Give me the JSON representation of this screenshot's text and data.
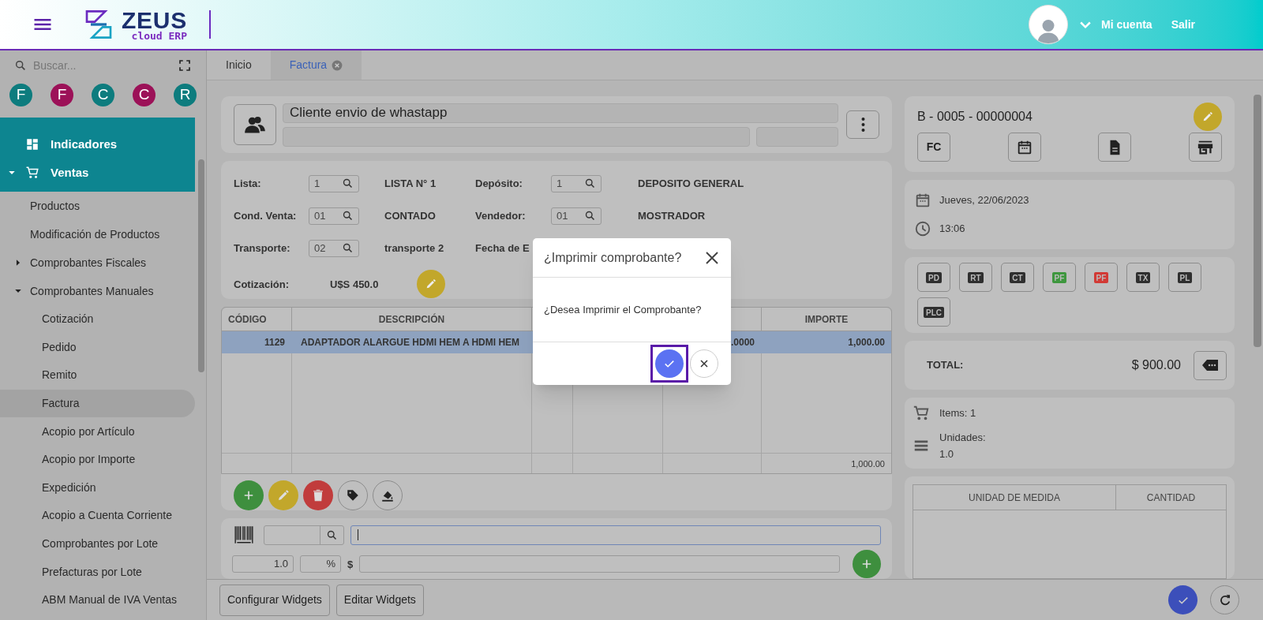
{
  "header": {
    "brand": "ZEUS",
    "brand_sub": "cloud ERP",
    "account": "Mi cuenta",
    "logout": "Salir"
  },
  "sidebar": {
    "search_placeholder": "Buscar...",
    "shortcuts": [
      {
        "letter": "F",
        "color": "#0d7c7e"
      },
      {
        "letter": "F",
        "color": "#9c1158"
      },
      {
        "letter": "C",
        "color": "#0d7c7e"
      },
      {
        "letter": "C",
        "color": "#9c1158"
      },
      {
        "letter": "R",
        "color": "#0d7c7e"
      }
    ],
    "items": [
      {
        "label": "Indicadores",
        "selected": false
      },
      {
        "label": "Ventas",
        "selected": false,
        "expanded": true,
        "children": [
          {
            "label": "Productos",
            "selected": false
          },
          {
            "label": "Modificación de Productos",
            "selected": false
          },
          {
            "label": "Comprobantes Fiscales",
            "selected": false,
            "expanded": false
          },
          {
            "label": "Comprobantes Manuales",
            "selected": false,
            "expanded": true,
            "children": [
              {
                "label": "Cotización",
                "selected": false
              },
              {
                "label": "Pedido",
                "selected": false
              },
              {
                "label": "Remito",
                "selected": false
              },
              {
                "label": "Factura",
                "selected": true
              },
              {
                "label": "Acopio por Artículo",
                "selected": false
              },
              {
                "label": "Acopio por Importe",
                "selected": false
              },
              {
                "label": "Expedición",
                "selected": false
              },
              {
                "label": "Acopio a Cuenta Corriente",
                "selected": false
              },
              {
                "label": "Comprobantes por Lote",
                "selected": false
              },
              {
                "label": "Prefacturas por Lote",
                "selected": false
              },
              {
                "label": "ABM Manual de IVA Ventas",
                "selected": false
              }
            ]
          }
        ]
      }
    ]
  },
  "tabs": [
    {
      "label": "Inicio",
      "selected": false,
      "closable": false
    },
    {
      "label": "Factura",
      "selected": true,
      "closable": true
    }
  ],
  "customer": {
    "name": "Cliente envio de whastapp"
  },
  "fields": [
    {
      "left": {
        "label": "Lista:",
        "code": "1",
        "value": "LISTA N° 1"
      },
      "right": {
        "label": "Depósito:",
        "code": "1",
        "value": "DEPOSITO GENERAL"
      }
    },
    {
      "left": {
        "label": "Cond. Venta:",
        "code": "01",
        "value": "CONTADO"
      },
      "right": {
        "label": "Vendedor:",
        "code": "01",
        "value": "MOSTRADOR"
      }
    },
    {
      "left": {
        "label": "Transporte:",
        "code": "02",
        "value": "transporte 2"
      },
      "right": {
        "label": "Fecha de E"
      }
    }
  ],
  "exchange": {
    "label": "Cotización:",
    "value": "U$S 450.0"
  },
  "table": {
    "columns": [
      {
        "label": "CÓDIGO"
      },
      {
        "label": "DESCRIPCIÓN"
      },
      {},
      {},
      {},
      {
        "label": "IMPORTE"
      }
    ],
    "rows": [
      {
        "selected": true,
        "cells": [
          "1129",
          "ADAPTADOR ALARGUE HDMI HEM A HDMI HEM",
          null,
          null,
          ".0000",
          "1,000.00"
        ]
      }
    ],
    "total_amount": "1,000.00"
  },
  "entry": {
    "quantity": "1.0",
    "discount_suffix": "%",
    "price_prefix": "$"
  },
  "voucher": {
    "number": "B - 0005 - 00000004",
    "type": "FC",
    "date": "Jueves, 22/06/2023",
    "time": "13:06"
  },
  "documents": [
    {
      "label": "PD",
      "color": "#2f2f2f"
    },
    {
      "label": "RT",
      "color": "#2f2f2f"
    },
    {
      "label": "CT",
      "color": "#2f2f2f"
    },
    {
      "label": "PF",
      "color": "#3e973e"
    },
    {
      "label": "PF",
      "color": "#d23a35"
    },
    {
      "label": "TX",
      "color": "#2f2f2f"
    },
    {
      "label": "PL",
      "color": "#2f2f2f"
    },
    {
      "label": "PLC",
      "color": "#2f2f2f"
    }
  ],
  "total": {
    "label": "TOTAL:",
    "value": "$ 900.00"
  },
  "summary": {
    "items": "Items: 1",
    "units_label": "Unidades:",
    "units": "1.0"
  },
  "units_table": {
    "columns": [
      "UNIDAD DE MEDIDA",
      "CANTIDAD"
    ]
  },
  "bottom_buttons": [
    "Configurar Widgets",
    "Editar Widgets"
  ],
  "modal": {
    "title": "¿Imprimir comprobante?",
    "message": "¿Desea Imprimir el Comprobante?"
  }
}
